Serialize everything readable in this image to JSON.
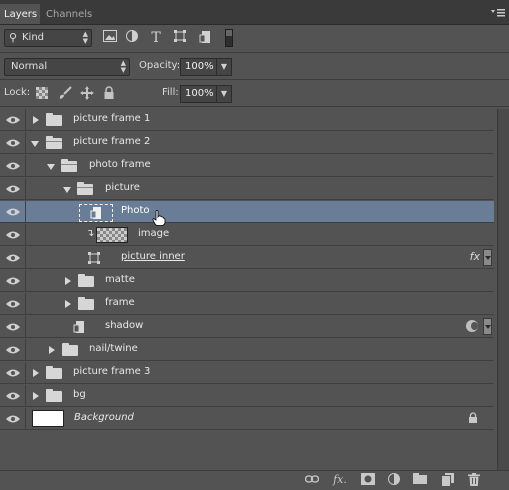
{
  "tabs": [
    {
      "label": "Layers",
      "active": true
    },
    {
      "label": "Channels",
      "active": false
    }
  ],
  "panel_menu_icon": "panel-menu-icon",
  "filter": {
    "kind_label": "Kind",
    "icons": [
      "image-filter-icon",
      "adjustment-filter-icon",
      "type-filter-icon",
      "shape-filter-icon",
      "smart-object-filter-icon"
    ]
  },
  "blend": {
    "mode": "Normal",
    "opacity_label": "Opacity:",
    "opacity_value": "100%"
  },
  "lock": {
    "label": "Lock:",
    "fill_label": "Fill:",
    "fill_value": "100%"
  },
  "layers": [
    {
      "name": "picture frame 1",
      "type": "group",
      "expanded": false,
      "depth": 0
    },
    {
      "name": "picture frame 2",
      "type": "group",
      "expanded": true,
      "depth": 0
    },
    {
      "name": "photo frame",
      "type": "group",
      "expanded": true,
      "depth": 1
    },
    {
      "name": "picture",
      "type": "group",
      "expanded": true,
      "depth": 2
    },
    {
      "name": "Photo",
      "type": "smart-object",
      "selected": true,
      "depth": 3
    },
    {
      "name": "image",
      "type": "clipped-pixel",
      "depth": 3
    },
    {
      "name": "picture inner",
      "type": "shape",
      "has_fx": true,
      "depth": 3
    },
    {
      "name": "matte",
      "type": "group",
      "expanded": false,
      "depth": 2
    },
    {
      "name": "frame",
      "type": "group",
      "expanded": false,
      "depth": 2
    },
    {
      "name": "shadow",
      "type": "smart-object",
      "has_mask": true,
      "depth": 2
    },
    {
      "name": "nail/twine",
      "type": "group",
      "expanded": false,
      "depth": 1
    },
    {
      "name": "picture frame 3",
      "type": "group",
      "expanded": false,
      "depth": 0
    },
    {
      "name": "bg",
      "type": "group",
      "expanded": false,
      "depth": 0
    },
    {
      "name": "Background",
      "type": "background",
      "locked": true,
      "depth": 0
    }
  ],
  "bottom_icons": [
    "link-layers-icon",
    "fx-icon",
    "add-mask-icon",
    "adjustment-layer-icon",
    "new-group-icon",
    "new-layer-icon",
    "delete-layer-icon"
  ],
  "colors": {
    "panel_bg": "#535353",
    "selected_row": "#6a7d96",
    "tab_bar": "#3a3a3a"
  }
}
